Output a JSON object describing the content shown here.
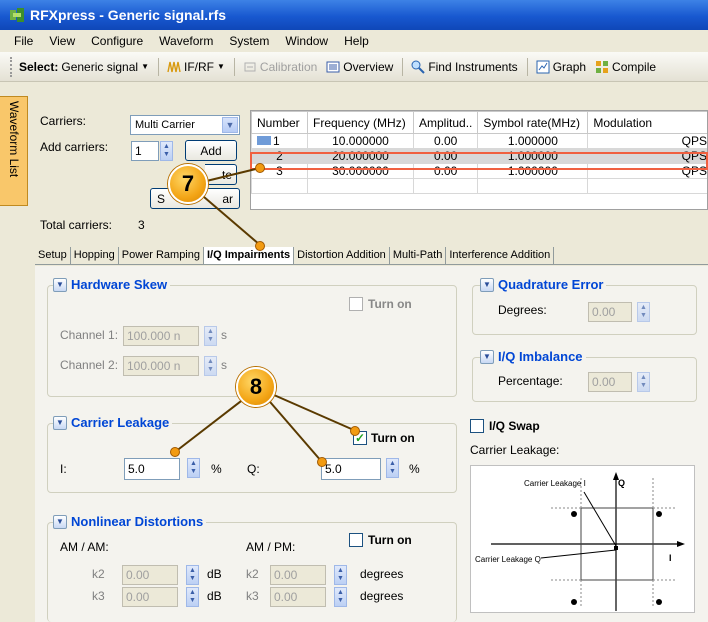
{
  "window": {
    "title": "RFXpress - Generic signal.rfs"
  },
  "menu": [
    "File",
    "View",
    "Configure",
    "Waveform",
    "System",
    "Window",
    "Help"
  ],
  "toolbar": {
    "select_label": "Select:",
    "generic_signal": "Generic signal",
    "if_rf": "IF/RF",
    "calibration": "Calibration",
    "overview": "Overview",
    "find_instruments": "Find Instruments",
    "graph": "Graph",
    "compile": "Compile"
  },
  "sidebar": {
    "tab": "Waveform List"
  },
  "carriers": {
    "label": "Carriers:",
    "mode": "Multi Carrier",
    "add_label": "Add carriers:",
    "add_value": "1",
    "add_button": "Add",
    "delete_button_fragment": "te",
    "select_button_left": "S",
    "select_button_right": "ar",
    "total_label": "Total carriers:",
    "total_value": "3"
  },
  "table": {
    "columns": [
      "Number",
      "Frequency (MHz)",
      "Amplitud..",
      "Symbol rate(MHz)",
      "Modulation"
    ],
    "rows": [
      [
        "1",
        "10.000000",
        "0.00",
        "1.000000",
        "QPSK"
      ],
      [
        "2",
        "20.000000",
        "0.00",
        "1.000000",
        "QPSK"
      ],
      [
        "3",
        "30.000000",
        "0.00",
        "1.000000",
        "QPSK"
      ]
    ]
  },
  "tabs": [
    "Setup",
    "Hopping",
    "Power Ramping",
    "I/Q Impairments",
    "Distortion Addition",
    "Multi-Path",
    "Interference Addition"
  ],
  "hardware_skew": {
    "title": "Hardware Skew",
    "turn_on": "Turn on",
    "ch1_label": "Channel 1:",
    "ch1_value": "100.000 n",
    "ch2_label": "Channel 2:",
    "ch2_value": "100.000 n",
    "unit": "s"
  },
  "quadrature": {
    "title": "Quadrature Error",
    "degrees_label": "Degrees:",
    "value": "0.00"
  },
  "imbalance": {
    "title": "I/Q Imbalance",
    "pct_label": "Percentage:",
    "value": "0.00"
  },
  "leakage": {
    "title": "Carrier Leakage",
    "turn_on": "Turn on",
    "i_label": "I:",
    "i_value": "5.0",
    "q_label": "Q:",
    "q_value": "5.0",
    "unit": "%"
  },
  "iqswap": {
    "label": "I/Q Swap",
    "leak_label": "Carrier Leakage:"
  },
  "diagram": {
    "leak_i": "Carrier Leakage I",
    "q": "Q",
    "leak_q": "Carrier Leakage Q",
    "i": "I"
  },
  "nonlinear": {
    "title": "Nonlinear Distortions",
    "turn_on": "Turn on",
    "am_am": "AM / AM:",
    "am_pm": "AM / PM:",
    "k2": "k2",
    "k3": "k3",
    "value": "0.00",
    "db": "dB",
    "degrees": "degrees"
  },
  "callouts": {
    "seven": "7",
    "eight": "8"
  }
}
